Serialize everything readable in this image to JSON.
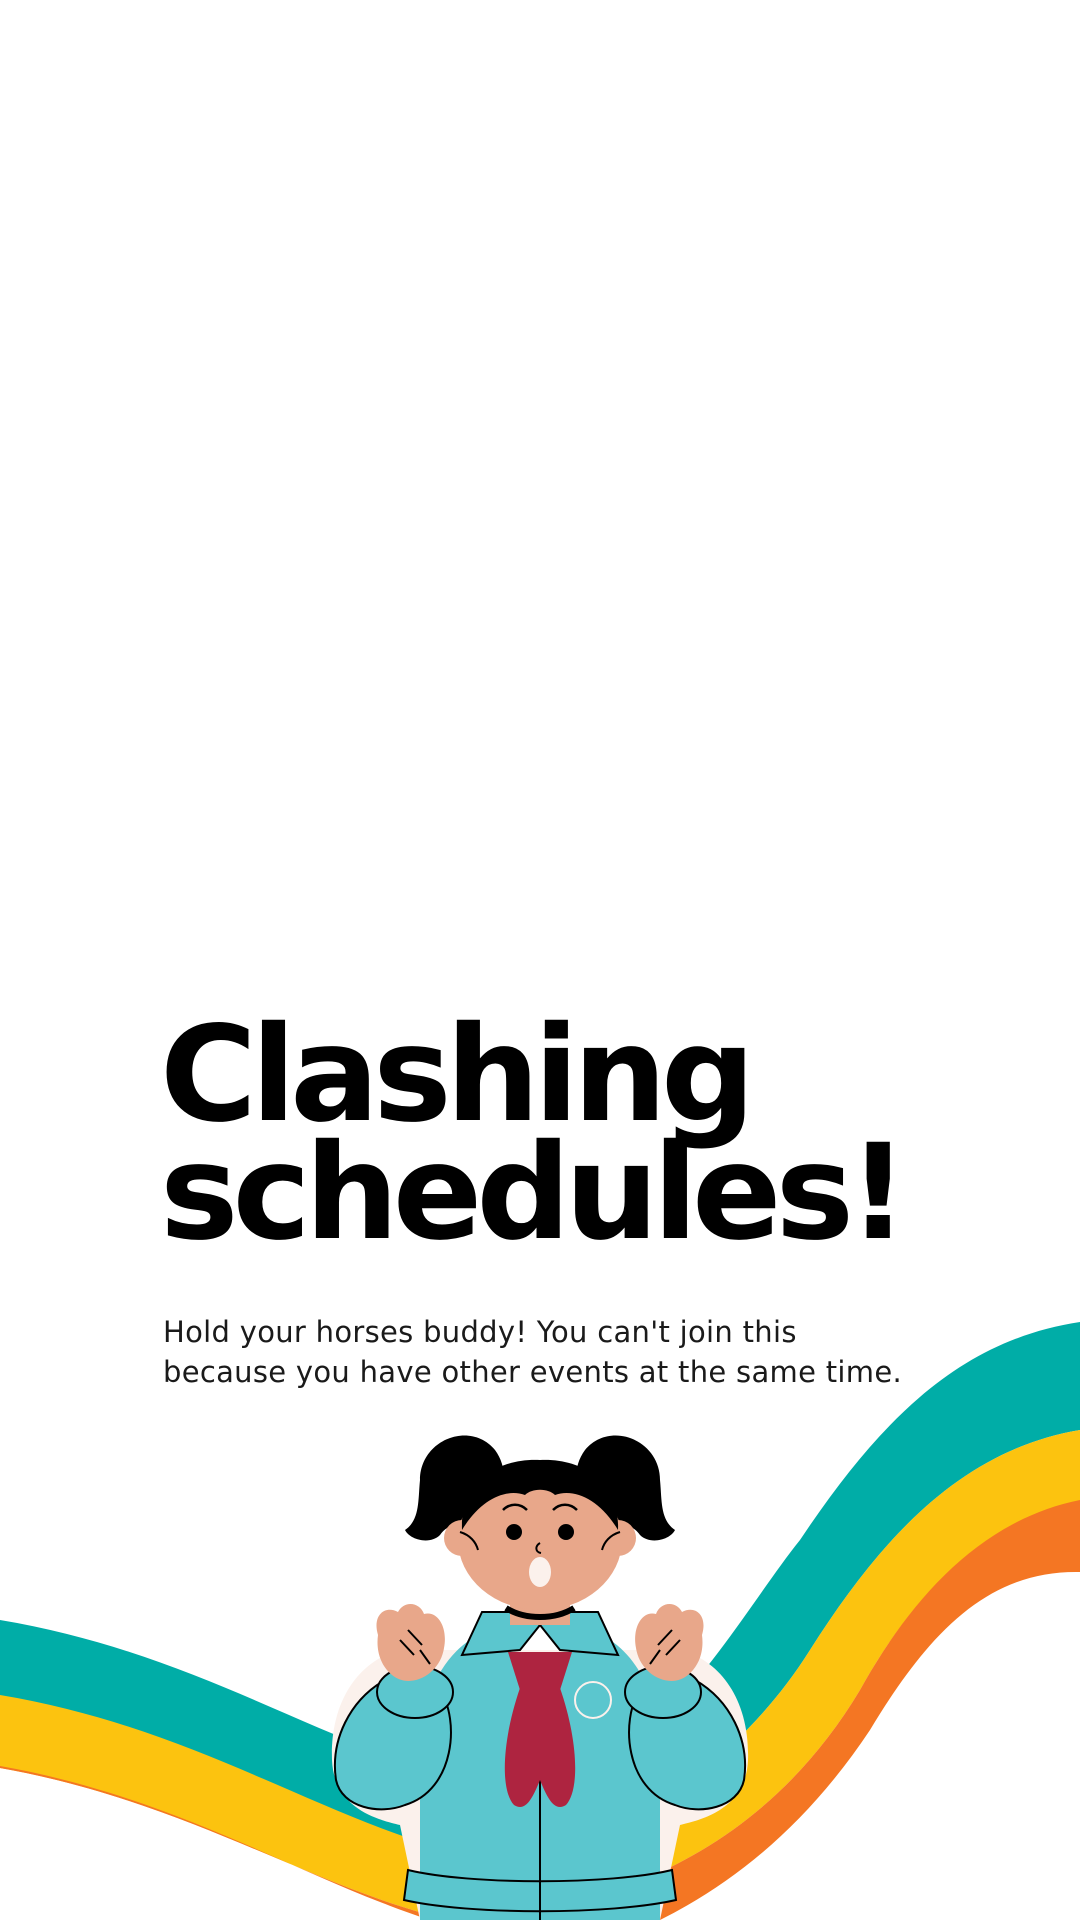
{
  "headline": {
    "line1": "Clashing",
    "line2": "schedules!"
  },
  "body": {
    "line1": "Hold your horses buddy! You can't join this",
    "line2": "because you have other events at the same time."
  },
  "illustration": {
    "subject": "surprised-girl-in-scout-uniform",
    "rainbow_colors": [
      "#00ADA7",
      "#FCC30F",
      "#F47623"
    ],
    "jacket_color": "#5BC6CE",
    "scarf_color": "#AE2440",
    "skin_color": "#E8A78A",
    "hair_color": "#000000"
  }
}
